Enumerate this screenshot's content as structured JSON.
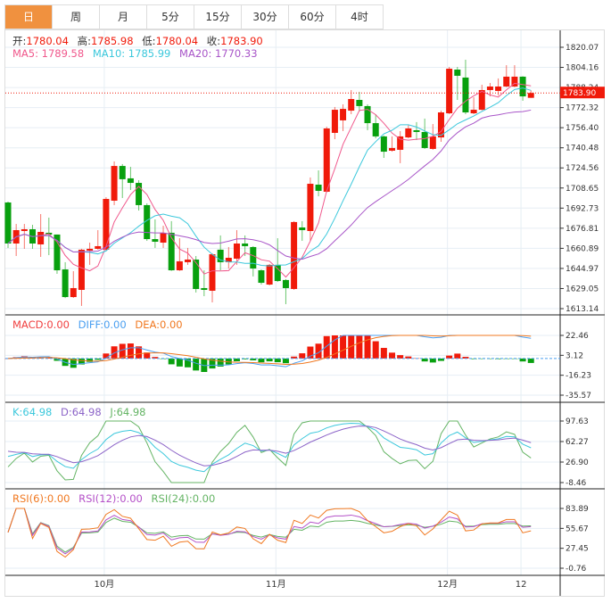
{
  "tabs": [
    {
      "label": "日",
      "active": true
    },
    {
      "label": "周"
    },
    {
      "label": "月"
    },
    {
      "label": "5分"
    },
    {
      "label": "15分"
    },
    {
      "label": "30分"
    },
    {
      "label": "60分"
    },
    {
      "label": "4时"
    }
  ],
  "ohlc_legend": {
    "open_label": "开:",
    "open": "1780.04",
    "high_label": "高:",
    "high": "1785.98",
    "low_label": "低:",
    "low": "1780.04",
    "close_label": "收:",
    "close": "1783.90"
  },
  "ma_legend": {
    "ma5": "MA5: 1789.58",
    "ma10": "MA10: 1785.99",
    "ma20": "MA20: 1770.33"
  },
  "macd_legend": {
    "macd": "MACD:0.00",
    "diff": "DIFF:0.00",
    "dea": "DEA:0.00"
  },
  "kdj_legend": {
    "k": "K:64.98",
    "d": "D:64.98",
    "j": "J:64.98"
  },
  "rsi_legend": {
    "rsi6": "RSI(6):0.00",
    "rsi12": "RSI(12):0.00",
    "rsi24": "RSI(24):0.00"
  },
  "colors": {
    "up": "#f01a0a",
    "down": "#08a00e",
    "ma5": "#f0588c",
    "ma10": "#3cc8dc",
    "ma20": "#a855c8",
    "diff": "#4a9ff0",
    "dea": "#f07820",
    "k": "#3cc8dc",
    "d": "#8c64c8",
    "j": "#64b464",
    "rsi6": "#f07820",
    "rsi12": "#b450c8",
    "rsi24": "#64b464",
    "tab_active": "#f0913f"
  },
  "chart_data": {
    "type": "candlestick",
    "price_axis": {
      "ticks": [
        "1820.07",
        "1804.16",
        "1788.24",
        "1772.32",
        "1756.40",
        "1740.48",
        "1724.56",
        "1708.65",
        "1692.73",
        "1676.81",
        "1660.89",
        "1644.97",
        "1629.05",
        "1613.14"
      ],
      "range": [
        1613.14,
        1820.07
      ]
    },
    "current_price": "1783.90",
    "macd_axis": {
      "ticks": [
        "22.46",
        "3.12",
        "-16.23",
        "-35.57"
      ],
      "range": [
        -35.57,
        22.46
      ]
    },
    "kdj_axis": {
      "ticks": [
        "97.63",
        "62.27",
        "26.90",
        "-8.46"
      ],
      "range": [
        -8.46,
        97.63
      ]
    },
    "rsi_axis": {
      "ticks": [
        "83.89",
        "55.67",
        "27.45",
        "-0.76"
      ],
      "range": [
        -0.76,
        83.89
      ]
    },
    "date_labels": [
      {
        "label": "10月",
        "index": 12
      },
      {
        "label": "11月",
        "index": 33
      },
      {
        "label": "12月",
        "index": 54
      },
      {
        "label": "12",
        "index": 63
      }
    ],
    "candles": [
      [
        1697.2,
        1697.9,
        1661.2,
        1664.7
      ],
      [
        1664.7,
        1680.2,
        1654.8,
        1675.3
      ],
      [
        1674.6,
        1680.2,
        1660.5,
        1676.0
      ],
      [
        1676.0,
        1679.5,
        1660.5,
        1664.7
      ],
      [
        1664.0,
        1688.0,
        1654.1,
        1673.9
      ],
      [
        1673.2,
        1685.2,
        1655.5,
        1671.8
      ],
      [
        1671.8,
        1671.8,
        1640.7,
        1643.5
      ],
      [
        1644.2,
        1649.9,
        1621.5,
        1622.3
      ],
      [
        1622.3,
        1642.8,
        1621.6,
        1629.4
      ],
      [
        1628.0,
        1660.5,
        1615.3,
        1659.8
      ],
      [
        1659.1,
        1665.4,
        1647.8,
        1660.5
      ],
      [
        1660.5,
        1675.3,
        1659.8,
        1662.6
      ],
      [
        1659.8,
        1701.4,
        1659.1,
        1700.0
      ],
      [
        1698.6,
        1729.7,
        1695.1,
        1726.1
      ],
      [
        1726.1,
        1727.6,
        1700.7,
        1715.6
      ],
      [
        1716.3,
        1725.4,
        1707.1,
        1712.7
      ],
      [
        1712.7,
        1714.8,
        1690.8,
        1695.1
      ],
      [
        1695.1,
        1696.5,
        1666.8,
        1668.2
      ],
      [
        1668.2,
        1683.8,
        1661.2,
        1666.1
      ],
      [
        1665.4,
        1678.8,
        1661.2,
        1673.2
      ],
      [
        1673.2,
        1682.4,
        1643.0,
        1643.5
      ],
      [
        1643.5,
        1668.9,
        1643.0,
        1650.6
      ],
      [
        1649.9,
        1661.2,
        1647.8,
        1652.0
      ],
      [
        1652.0,
        1654.8,
        1625.9,
        1628.7
      ],
      [
        1629.4,
        1643.5,
        1623.0,
        1628.0
      ],
      [
        1627.3,
        1656.9,
        1618.1,
        1656.2
      ],
      [
        1659.8,
        1671.1,
        1643.5,
        1649.9
      ],
      [
        1649.9,
        1661.9,
        1644.9,
        1653.4
      ],
      [
        1652.7,
        1675.3,
        1647.8,
        1664.7
      ],
      [
        1664.7,
        1671.1,
        1654.8,
        1662.6
      ],
      [
        1661.9,
        1662.6,
        1638.6,
        1644.9
      ],
      [
        1643.5,
        1644.2,
        1632.2,
        1633.6
      ],
      [
        1632.2,
        1648.5,
        1631.5,
        1647.8
      ],
      [
        1647.8,
        1668.9,
        1634.3,
        1635.0
      ],
      [
        1635.8,
        1636.5,
        1616.7,
        1629.4
      ],
      [
        1628.7,
        1682.4,
        1628.0,
        1681.7
      ],
      [
        1677.4,
        1682.4,
        1666.8,
        1675.3
      ],
      [
        1674.6,
        1717.0,
        1666.8,
        1712.0
      ],
      [
        1711.3,
        1722.6,
        1702.1,
        1706.4
      ],
      [
        1705.7,
        1757.2,
        1705.0,
        1755.8
      ],
      [
        1752.3,
        1772.8,
        1747.3,
        1770.6
      ],
      [
        1762.2,
        1774.9,
        1753.7,
        1771.3
      ],
      [
        1769.9,
        1786.2,
        1767.1,
        1779.1
      ],
      [
        1778.4,
        1784.8,
        1769.2,
        1773.5
      ],
      [
        1773.5,
        1774.9,
        1754.4,
        1760.0
      ],
      [
        1760.0,
        1767.1,
        1748.0,
        1749.5
      ],
      [
        1749.5,
        1750.2,
        1732.5,
        1737.4
      ],
      [
        1738.2,
        1749.5,
        1737.4,
        1740.3
      ],
      [
        1738.9,
        1753.7,
        1728.3,
        1749.5
      ],
      [
        1748.7,
        1758.6,
        1748.0,
        1755.8
      ],
      [
        1754.4,
        1760.8,
        1746.6,
        1753.0
      ],
      [
        1753.0,
        1763.6,
        1739.6,
        1740.3
      ],
      [
        1739.6,
        1759.3,
        1738.9,
        1749.5
      ],
      [
        1748.7,
        1769.9,
        1745.2,
        1768.5
      ],
      [
        1767.8,
        1804.5,
        1767.1,
        1803.1
      ],
      [
        1802.4,
        1804.5,
        1778.4,
        1797.5
      ],
      [
        1796.1,
        1810.2,
        1767.1,
        1768.5
      ],
      [
        1767.8,
        1780.5,
        1767.1,
        1770.6
      ],
      [
        1770.6,
        1790.4,
        1770.0,
        1786.2
      ],
      [
        1786.2,
        1791.8,
        1781.2,
        1789.0
      ],
      [
        1785.5,
        1795.4,
        1781.9,
        1789.0
      ],
      [
        1789.0,
        1805.9,
        1788.5,
        1796.8
      ],
      [
        1789.0,
        1805.9,
        1788.5,
        1796.8
      ],
      [
        1796.8,
        1797.2,
        1777.7,
        1781.2
      ],
      [
        1780.04,
        1785.98,
        1780.04,
        1783.9
      ]
    ]
  }
}
